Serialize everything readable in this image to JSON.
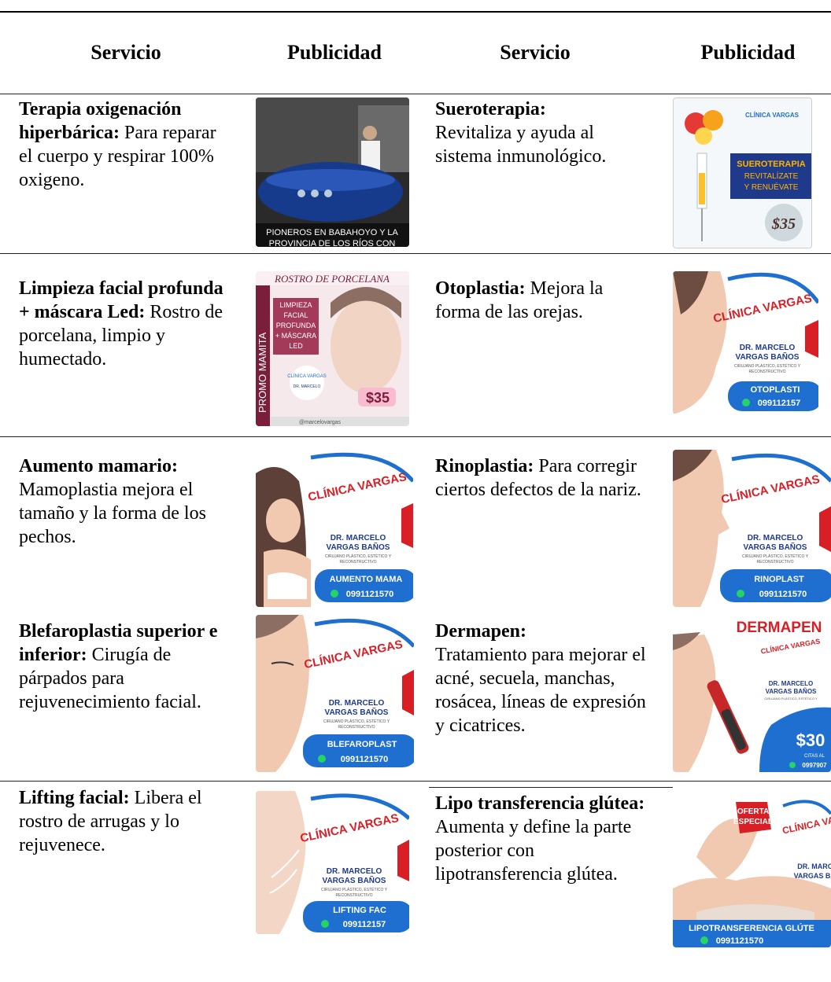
{
  "table": {
    "headers": [
      "Servicio",
      "Publicidad",
      "Servicio",
      "Publicidad"
    ],
    "rows": [
      {
        "left": {
          "title": "Terapia oxigenación hiperbárica:",
          "text": "Para reparar el cuerpo y respirar 100% oxigeno."
        },
        "right": {
          "title": "Sueroterapia:",
          "text": "Revitaliza y ayuda al sistema inmunológico."
        }
      },
      {
        "left": {
          "title": "Limpieza facial profunda + máscara Led:",
          "text": "Rostro de porcelana, limpio y humectado."
        },
        "right": {
          "title": "Otoplastia:",
          "text": "Mejora la forma de las orejas."
        }
      },
      {
        "left": {
          "title": "Aumento mamario:",
          "text": "Mamoplastia mejora el tamaño y la forma de los pechos."
        },
        "right": {
          "title": "Rinoplastia:",
          "text": "Para corregir ciertos defectos de la nariz."
        }
      },
      {
        "left": {
          "title": "Blefaroplastia superior e inferior:",
          "text": "Cirugía de párpados para rejuvenecimiento facial."
        },
        "right": {
          "title": "Dermapen:",
          "text": "Tratamiento para mejorar el acné, secuela, manchas, rosácea, líneas de expresión y cicatrices."
        }
      },
      {
        "left": {
          "title": "Lifting facial:",
          "text": "Libera el rostro de arrugas y lo rejuvenece."
        },
        "right": {
          "title": "Lipo transferencia glútea:",
          "text": "Aumenta y define la parte posterior con lipotransferencia glútea."
        }
      }
    ]
  },
  "ads": {
    "oxigeno": {
      "caption1": "PIONEROS EN BABAHOYO Y LA",
      "caption2": "PROVINCIA DE LOS RÍOS CON"
    },
    "suero": {
      "brand": "CLÍNICA VARGAS",
      "line1": "SUEROTERAPIA",
      "line2": "REVITALÍZATE",
      "line3": "Y RENUÉVATE",
      "price": "$35"
    },
    "limpieza": {
      "banner": "ROSTRO DE PORCELANA",
      "side": "PROMO MAMITA",
      "l1": "LIMPIEZA",
      "l2": "FACIAL",
      "l3": "PROFUNDA",
      "l4": "+ MÁSCARA",
      "l5": "LED",
      "price": "$35",
      "handle": "@marcelovargas"
    },
    "common": {
      "brand": "CLÍNICA VARGAS",
      "doctor1": "DR. MARCELO",
      "doctor2": "VARGAS BAÑOS",
      "specialty1": "CIRUJANO PLÁSTICO, ESTÉTICO Y",
      "specialty2": "RECONSTRUCTIVO",
      "phone": "0991121570"
    },
    "otoplastia": {
      "label": "OTOPLASTI",
      "phone": "099112157"
    },
    "mamario": {
      "label": "AUMENTO MAMA",
      "phone": "0991121570"
    },
    "rino": {
      "label": "RINOPLAST",
      "phone": "0991121570"
    },
    "blefaro": {
      "label": "BLEFAROPLAST",
      "phone": "0991121570"
    },
    "dermapen": {
      "title": "DERMAPEN",
      "price": "$30",
      "citas": "CITAS AL",
      "phone": "0997907"
    },
    "lifting": {
      "label": "LIFTING FAC",
      "phone": "099112157"
    },
    "lipo": {
      "label": "LIPOTRANSFERENCIA GLÚTE",
      "phone": "0991121570",
      "offer1": "OFERTA",
      "offer2": "ESPECIAL"
    }
  },
  "colors": {
    "blue": "#1e6fd0",
    "darkblue": "#1f3a8a",
    "red": "#d81f26",
    "orange": "#e36b1c"
  }
}
